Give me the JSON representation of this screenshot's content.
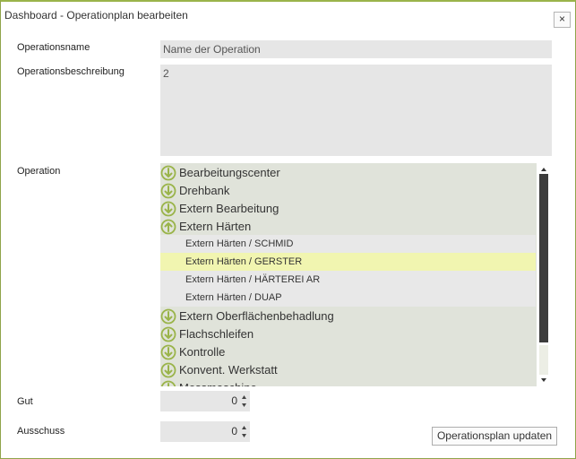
{
  "window": {
    "title": "Dashboard - Operationplan bearbeiten",
    "close_glyph": "×",
    "accent_color": "#9ab44a"
  },
  "form": {
    "name_label": "Operationsname",
    "name_value": "Name der Operation",
    "desc_label": "Operationsbeschreibung",
    "desc_value": "2",
    "operation_label": "Operation",
    "gut_label": "Gut",
    "gut_value": "0",
    "ausschuss_label": "Ausschuss",
    "ausschuss_value": "0",
    "update_button": "Operationsplan updaten"
  },
  "operations": [
    {
      "kind": "group",
      "label": "Bearbeitungscenter",
      "icon": "expand-down-icon"
    },
    {
      "kind": "group",
      "label": "Drehbank",
      "icon": "expand-down-icon"
    },
    {
      "kind": "group",
      "label": "Extern Bearbeitung",
      "icon": "expand-down-icon"
    },
    {
      "kind": "group",
      "label": "Extern Härten",
      "icon": "collapse-up-icon"
    },
    {
      "kind": "child",
      "label": "Extern Härten  / SCHMID"
    },
    {
      "kind": "child",
      "label": "Extern Härten  / GERSTER",
      "selected": true
    },
    {
      "kind": "child",
      "label": "Extern Härten  / HÄRTEREI AR"
    },
    {
      "kind": "child",
      "label": "Extern Härten  / DUAP"
    },
    {
      "kind": "group",
      "label": "Extern Oberflächenbehadlung",
      "icon": "expand-down-icon"
    },
    {
      "kind": "group",
      "label": "Flachschleifen",
      "icon": "expand-down-icon"
    },
    {
      "kind": "group",
      "label": "Kontrolle",
      "icon": "expand-down-icon"
    },
    {
      "kind": "group",
      "label": "Konvent. Werkstatt",
      "icon": "expand-down-icon"
    },
    {
      "kind": "group",
      "label": "Messmaschine",
      "icon": "expand-down-icon"
    }
  ]
}
